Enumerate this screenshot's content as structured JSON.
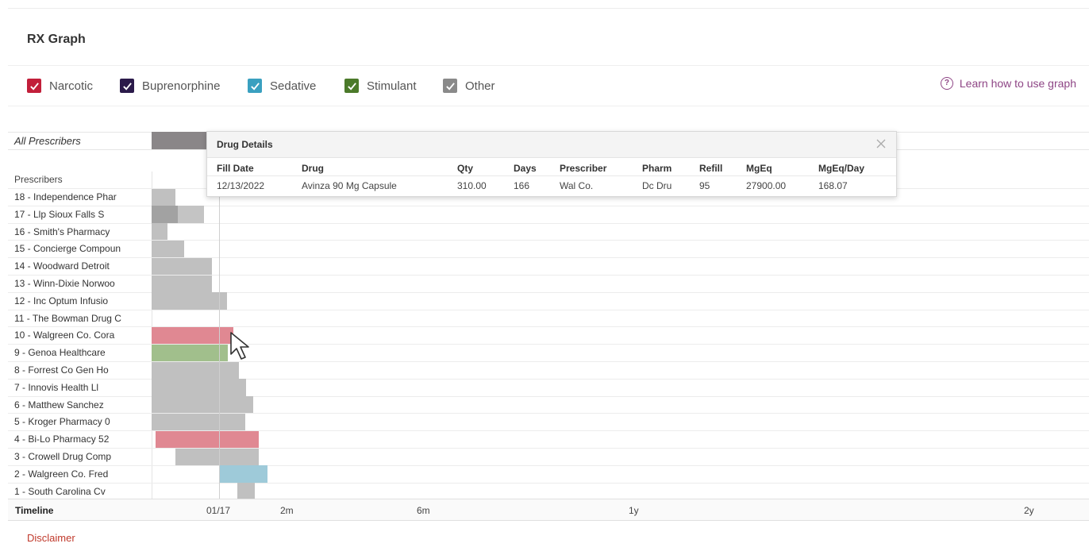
{
  "header": {
    "title": "RX Graph"
  },
  "legend": {
    "items": [
      {
        "label": "Narcotic",
        "color": "#c21f3a",
        "checked": true
      },
      {
        "label": "Buprenorphine",
        "color": "#2b1a4a",
        "checked": true
      },
      {
        "label": "Sedative",
        "color": "#3aa0c0",
        "checked": true
      },
      {
        "label": "Stimulant",
        "color": "#4b7a2a",
        "checked": true
      },
      {
        "label": "Other",
        "color": "#8a8a8a",
        "checked": true
      }
    ],
    "help_link": "Learn how to use graph"
  },
  "graph": {
    "all_prescribers_label": "All Prescribers",
    "prescribers_header": "Prescribers",
    "rows": [
      {
        "label": "18 - Independence Phar",
        "bars": [
          {
            "color": "#c0c0c0",
            "start": 0,
            "width": 30
          }
        ]
      },
      {
        "label": "17 - Llp Sioux Falls S",
        "bars": [
          {
            "color": "#a2a2a2",
            "start": 0,
            "width": 33
          },
          {
            "color": "#c4c4c4",
            "start": 33,
            "width": 33
          }
        ]
      },
      {
        "label": "16 - Smith's Pharmacy",
        "bars": [
          {
            "color": "#c0c0c0",
            "start": 0,
            "width": 20
          }
        ]
      },
      {
        "label": "15 - Concierge Compoun",
        "bars": [
          {
            "color": "#c0c0c0",
            "start": 0,
            "width": 41
          }
        ]
      },
      {
        "label": "14 - Woodward Detroit",
        "bars": [
          {
            "color": "#c0c0c0",
            "start": 0,
            "width": 76
          }
        ]
      },
      {
        "label": "13 - Winn-Dixie Norwoo",
        "bars": [
          {
            "color": "#c0c0c0",
            "start": 0,
            "width": 76
          }
        ]
      },
      {
        "label": "12 - Inc Optum Infusio",
        "bars": [
          {
            "color": "#c0c0c0",
            "start": 0,
            "width": 95
          }
        ]
      },
      {
        "label": "11 - The Bowman Drug C",
        "bars": []
      },
      {
        "label": "10 - Walgreen Co. Cora",
        "bars": [
          {
            "color": "#e08892",
            "start": 0,
            "width": 103
          }
        ]
      },
      {
        "label": "9 - Genoa Healthcare",
        "bars": [
          {
            "color": "#a1bf8c",
            "start": 0,
            "width": 96
          }
        ]
      },
      {
        "label": "8 - Forrest Co Gen Ho",
        "bars": [
          {
            "color": "#c0c0c0",
            "start": 0,
            "width": 110
          }
        ]
      },
      {
        "label": "7 - Innovis Health Ll",
        "bars": [
          {
            "color": "#c0c0c0",
            "start": 0,
            "width": 119
          }
        ]
      },
      {
        "label": "6 - Matthew Sanchez",
        "bars": [
          {
            "color": "#c0c0c0",
            "start": 0,
            "width": 128
          }
        ]
      },
      {
        "label": "5 - Kroger Pharmacy 0",
        "bars": [
          {
            "color": "#c0c0c0",
            "start": 0,
            "width": 118
          }
        ]
      },
      {
        "label": "4 - Bi-Lo Pharmacy 52",
        "bars": [
          {
            "color": "#e08892",
            "start": 5,
            "width": 130
          }
        ]
      },
      {
        "label": "3 - Crowell Drug Comp",
        "bars": [
          {
            "color": "#c0c0c0",
            "start": 30,
            "width": 105
          }
        ]
      },
      {
        "label": "2 - Walgreen Co. Fred",
        "bars": [
          {
            "color": "#9ecad9",
            "start": 86,
            "width": 60
          }
        ]
      },
      {
        "label": "1 - South Carolina Cv",
        "bars": [
          {
            "color": "#c0c0c0",
            "start": 108,
            "width": 22
          }
        ]
      }
    ],
    "timeline": {
      "label": "Timeline",
      "ticks": [
        "01/17",
        "2m",
        "6m",
        "1y",
        "2y"
      ]
    }
  },
  "popup": {
    "title": "Drug Details",
    "columns": [
      "Fill Date",
      "Drug",
      "Qty",
      "Days",
      "Prescriber",
      "Pharm",
      "Refill",
      "MgEq",
      "MgEq/Day"
    ],
    "row": [
      "12/13/2022",
      "Avinza 90 Mg Capsule",
      "310.00",
      "166",
      "Wal Co.",
      "Dc Dru",
      "95",
      "27900.00",
      "168.07"
    ]
  },
  "footer": {
    "disclaimer": "Disclaimer"
  }
}
